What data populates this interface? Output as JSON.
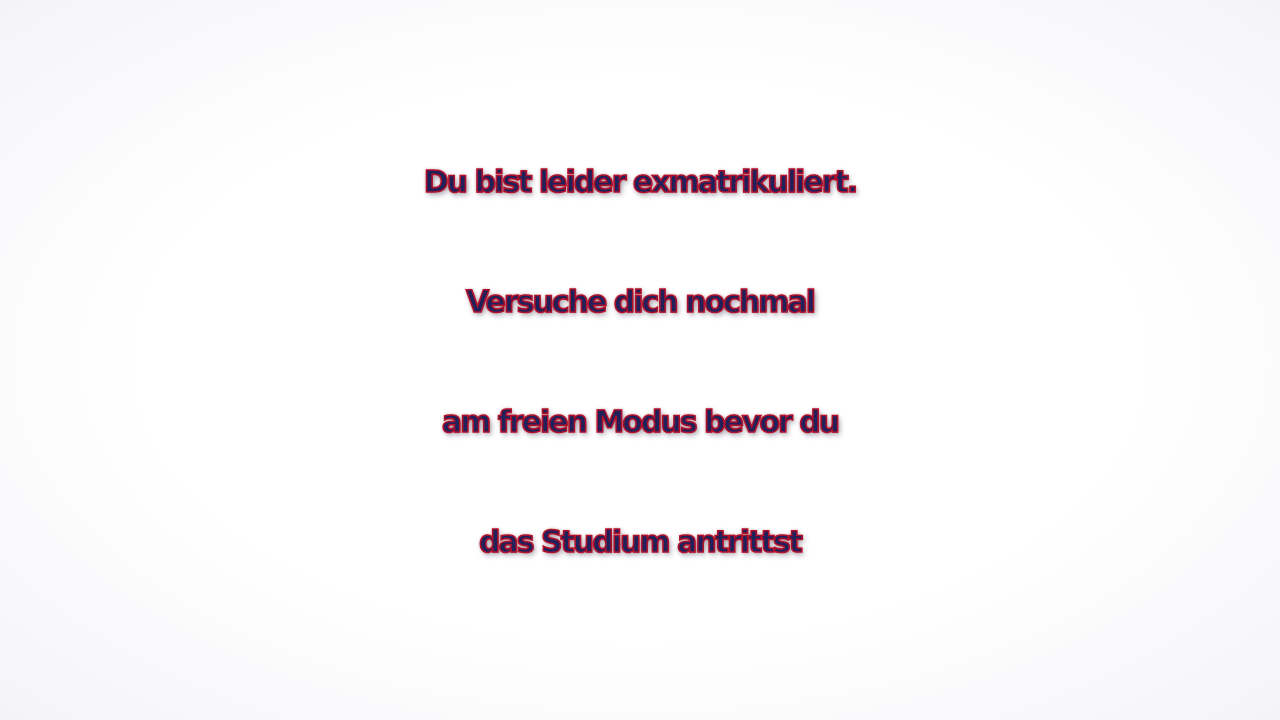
{
  "message": {
    "lines": [
      "Du bist leider exmatrikuliert.",
      "Versuche dich nochmal",
      "am freien Modus bevor du",
      "das Studium antrittst"
    ]
  },
  "colors": {
    "text_fill": "#20205a",
    "text_outline": "#b0102a",
    "background": "#ffffff"
  }
}
